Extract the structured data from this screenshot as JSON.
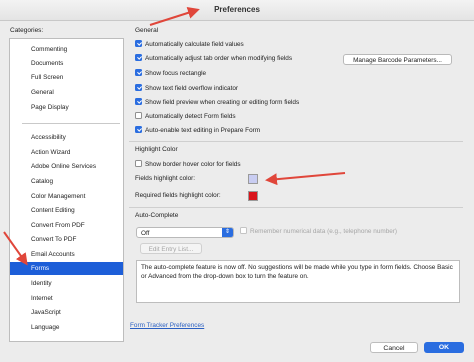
{
  "window": {
    "title": "Preferences"
  },
  "categories": {
    "label": "Categories:",
    "group1": [
      "Commenting",
      "Documents",
      "Full Screen",
      "General",
      "Page Display"
    ],
    "group2": [
      "Accessibility",
      "Action Wizard",
      "Adobe Online Services",
      "Catalog",
      "Color Management",
      "Content Editing",
      "Convert From PDF",
      "Convert To PDF",
      "Email Accounts",
      "Forms",
      "Identity",
      "Internet",
      "JavaScript",
      "Language"
    ],
    "selected": "Forms"
  },
  "general": {
    "label": "General",
    "options": [
      {
        "label": "Automatically calculate field values",
        "checked": true
      },
      {
        "label": "Automatically adjust tab order when modifying fields",
        "checked": true
      },
      {
        "label": "Show focus rectangle",
        "checked": true
      },
      {
        "label": "Show text field overflow indicator",
        "checked": true
      },
      {
        "label": "Show field preview when creating or editing form fields",
        "checked": true
      },
      {
        "label": "Automatically detect Form fields",
        "checked": false
      },
      {
        "label": "Auto-enable text editing in Prepare Form",
        "checked": true
      }
    ],
    "barcode_button": "Manage Barcode Parameters..."
  },
  "highlight": {
    "label": "Highlight Color",
    "border_hover": {
      "label": "Show border hover color for fields",
      "checked": false
    },
    "fields_color_label": "Fields highlight color:",
    "fields_color": "#c9cdf2",
    "required_color_label": "Required fields highlight color:",
    "required_color": "#d9141b"
  },
  "autocomplete": {
    "label": "Auto-Complete",
    "select_value": "Off",
    "remember": {
      "label": "Remember numerical data (e.g., telephone number)",
      "checked": false
    },
    "edit_button": "Edit Entry List...",
    "info": "The auto-complete feature is now off. No suggestions will be made while you type in form fields. Choose Basic or Advanced from the drop-down box to turn the feature on."
  },
  "footer": {
    "link": "Form Tracker Preferences",
    "cancel": "Cancel",
    "ok": "OK"
  },
  "colors": {
    "accent": "#1d5ed8",
    "annotation_arrow": "#e0463a"
  }
}
